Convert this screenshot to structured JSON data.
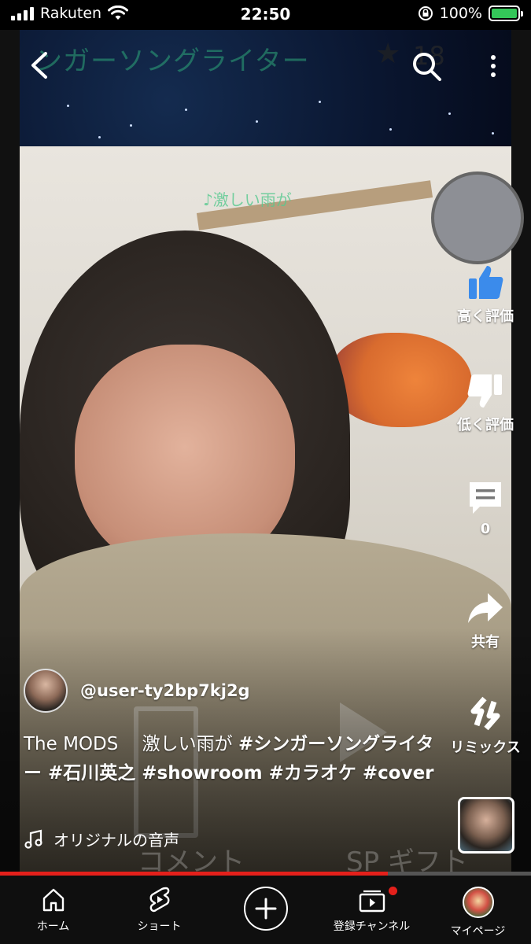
{
  "status_bar": {
    "carrier": "Rakuten",
    "time": "22:50",
    "battery": "100%"
  },
  "video": {
    "banner_text": "ンガーソングライター",
    "banner_count": "18",
    "lyric_overlay": "♪激しい雨が",
    "overlay_comment": "コメント",
    "overlay_gift": "SP ギフト"
  },
  "right_rail": {
    "like_label": "高く評価",
    "dislike_label": "低く評価",
    "comment_count": "0",
    "share_label": "共有",
    "remix_label": "リミックス"
  },
  "channel": {
    "handle": "@user-ty2bp7kj2g"
  },
  "description": {
    "title": "The MODS　 激しい雨が ",
    "tags": "#シンガーソングライター #石川英之 #showroom #カラオケ #cover"
  },
  "audio": {
    "label": "オリジナルの音声"
  },
  "progress": {
    "fraction": 0.73
  },
  "nav": {
    "home": "ホーム",
    "shorts": "ショート",
    "subscriptions": "登録チャンネル",
    "mypage": "マイページ"
  },
  "colors": {
    "accent": "#e4201b",
    "battery": "#34c759",
    "like": "#3b8beb"
  }
}
